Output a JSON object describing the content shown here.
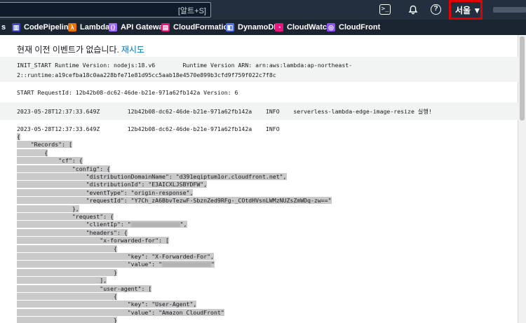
{
  "topbar": {
    "search_shortcut": "[알트+S]",
    "region": "서울 ▼",
    "icons": [
      "cloudshell-icon",
      "bell-icon",
      "help-icon"
    ]
  },
  "favorites": [
    {
      "label": "s",
      "icon": "",
      "color": "#232f3e"
    },
    {
      "label": "CodePipeline",
      "icon": "codepipeline-icon",
      "color": "#3f48cc"
    },
    {
      "label": "Lambda",
      "icon": "lambda-icon",
      "color": "#ed7100"
    },
    {
      "label": "API Gateway",
      "icon": "api-gateway-icon",
      "color": "#a166ff"
    },
    {
      "label": "CloudFormation",
      "icon": "cloudformation-icon",
      "color": "#e7157b"
    },
    {
      "label": "DynamoDB",
      "icon": "dynamodb-icon",
      "color": "#4d72f3"
    },
    {
      "label": "CloudWatch",
      "icon": "cloudwatch-icon",
      "color": "#e7157b"
    },
    {
      "label": "CloudFront",
      "icon": "cloudfront-icon",
      "color": "#8c4fff"
    }
  ],
  "notice": {
    "text": "현재 이전 이벤트가 없습니다.",
    "link": "재시도"
  },
  "log": {
    "init_line1": "INIT_START Runtime Version: nodejs:18.v6        Runtime Version ARN: arn:aws:lambda:ap-northeast-",
    "init_line2": "2::runtime:a19cefba18c0aa228bfe71e81d95cc5aab18e4570e899b3cfd9f759f022c7f8c",
    "start_line": "START RequestId: 12b42b08-dc62-46de-b21e-971a62fb142a Version: 6",
    "info1": "2023-05-28T12:37:33.649Z        12b42b08-dc62-46de-b21e-971a62fb142a    INFO    serverless-lambda-edge-image-resize 실행!",
    "info2": "2023-05-28T12:37:33.649Z        12b42b08-dc62-46de-b21e-971a62fb142a    INFO",
    "json_lines": [
      "{",
      "    \"Records\": [",
      "        {",
      "            \"cf\": {",
      "                \"config\": {",
      "                    \"distributionDomainName\": \"d391eqiptum1or.cloudfront.net\",",
      "                    \"distributionId\": \"E3AICXLJSBYDFW\",",
      "                    \"eventType\": \"origin-response\",",
      "                    \"requestId\": \"Y7Ch_zA6BbvTezwF-SbznZed9RFg-_COtdHVsnLWMzNUZsZmWDq-zw==\"",
      "                },",
      "                \"request\": {",
      "                    \"clientIp\": \"[[redacted-ip]]\",",
      "                    \"headers\": {",
      "                        \"x-forwarded-for\": [",
      "                            {",
      "                                \"key\": \"X-Forwarded-For\",",
      "                                \"value\": \"[[redacted-ip]]\"",
      "                            }",
      "                        ],",
      "                        \"user-agent\": [",
      "                            {",
      "                                \"key\": \"User-Agent\",",
      "                                \"value\": \"Amazon CloudFront\"",
      "                            }"
    ]
  }
}
